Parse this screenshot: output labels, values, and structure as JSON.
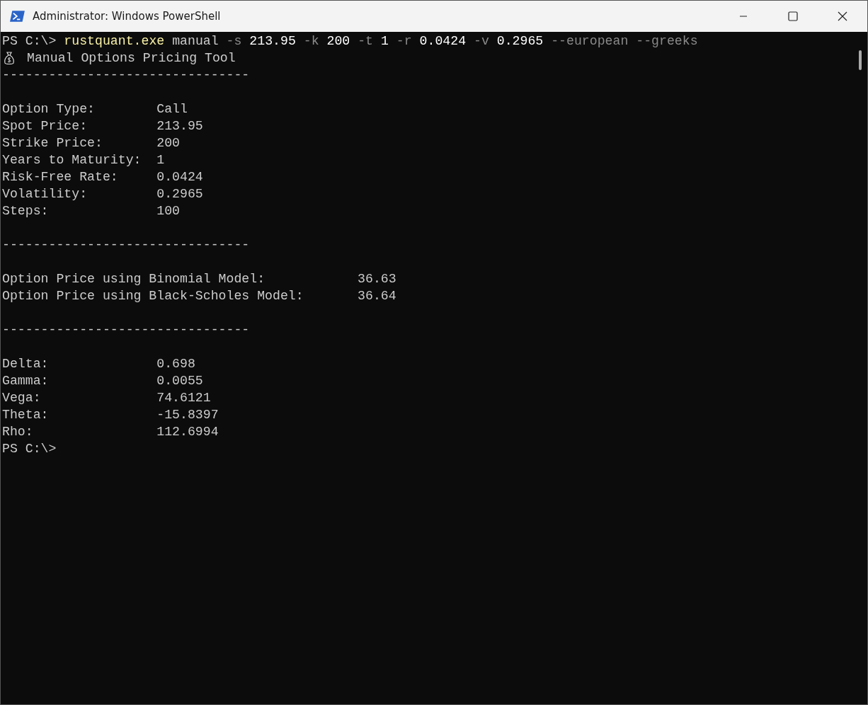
{
  "window": {
    "title": "Administrator: Windows PowerShell"
  },
  "terminal": {
    "lines": [
      {
        "kind": "command",
        "prompt": "PS C:\\>",
        "tokens": [
          {
            "text": "rustquant.exe",
            "kind": "command"
          },
          {
            "text": "manual",
            "kind": "argument"
          },
          {
            "text": "-s",
            "kind": "parameter"
          },
          {
            "text": "213.95",
            "kind": "number"
          },
          {
            "text": "-k",
            "kind": "parameter"
          },
          {
            "text": "200",
            "kind": "number"
          },
          {
            "text": "-t",
            "kind": "parameter"
          },
          {
            "text": "1",
            "kind": "number"
          },
          {
            "text": "-r",
            "kind": "parameter"
          },
          {
            "text": "0.0424",
            "kind": "number"
          },
          {
            "text": "-v",
            "kind": "parameter"
          },
          {
            "text": "0.2965",
            "kind": "number"
          },
          {
            "text": "--european",
            "kind": "parameter"
          },
          {
            "text": "--greeks",
            "kind": "parameter"
          }
        ]
      },
      {
        "kind": "heading",
        "text": "Manual Options Pricing Tool"
      },
      {
        "kind": "text",
        "text": "--------------------------------"
      },
      {
        "kind": "blank"
      },
      {
        "kind": "field",
        "label": "Option Type:",
        "value": "Call"
      },
      {
        "kind": "field",
        "label": "Spot Price:",
        "value": "213.95"
      },
      {
        "kind": "field",
        "label": "Strike Price:",
        "value": "200"
      },
      {
        "kind": "field",
        "label": "Years to Maturity:",
        "value": "1"
      },
      {
        "kind": "field",
        "label": "Risk-Free Rate:",
        "value": "0.0424"
      },
      {
        "kind": "field",
        "label": "Volatility:",
        "value": "0.2965"
      },
      {
        "kind": "field",
        "label": "Steps:",
        "value": "100"
      },
      {
        "kind": "blank"
      },
      {
        "kind": "text",
        "text": "--------------------------------"
      },
      {
        "kind": "blank"
      },
      {
        "kind": "price",
        "label": "Option Price using Binomial Model:",
        "value": "36.63"
      },
      {
        "kind": "price",
        "label": "Option Price using Black-Scholes Model:",
        "value": "36.64"
      },
      {
        "kind": "blank"
      },
      {
        "kind": "text",
        "text": "--------------------------------"
      },
      {
        "kind": "blank"
      },
      {
        "kind": "field",
        "label": "Delta:",
        "value": "0.698"
      },
      {
        "kind": "field",
        "label": "Gamma:",
        "value": "0.0055"
      },
      {
        "kind": "field",
        "label": "Vega:",
        "value": "74.6121"
      },
      {
        "kind": "field",
        "label": "Theta:",
        "value": "-15.8397"
      },
      {
        "kind": "field",
        "label": "Rho:",
        "value": "112.6994"
      },
      {
        "kind": "prompt",
        "prompt": "PS C:\\>"
      }
    ]
  }
}
